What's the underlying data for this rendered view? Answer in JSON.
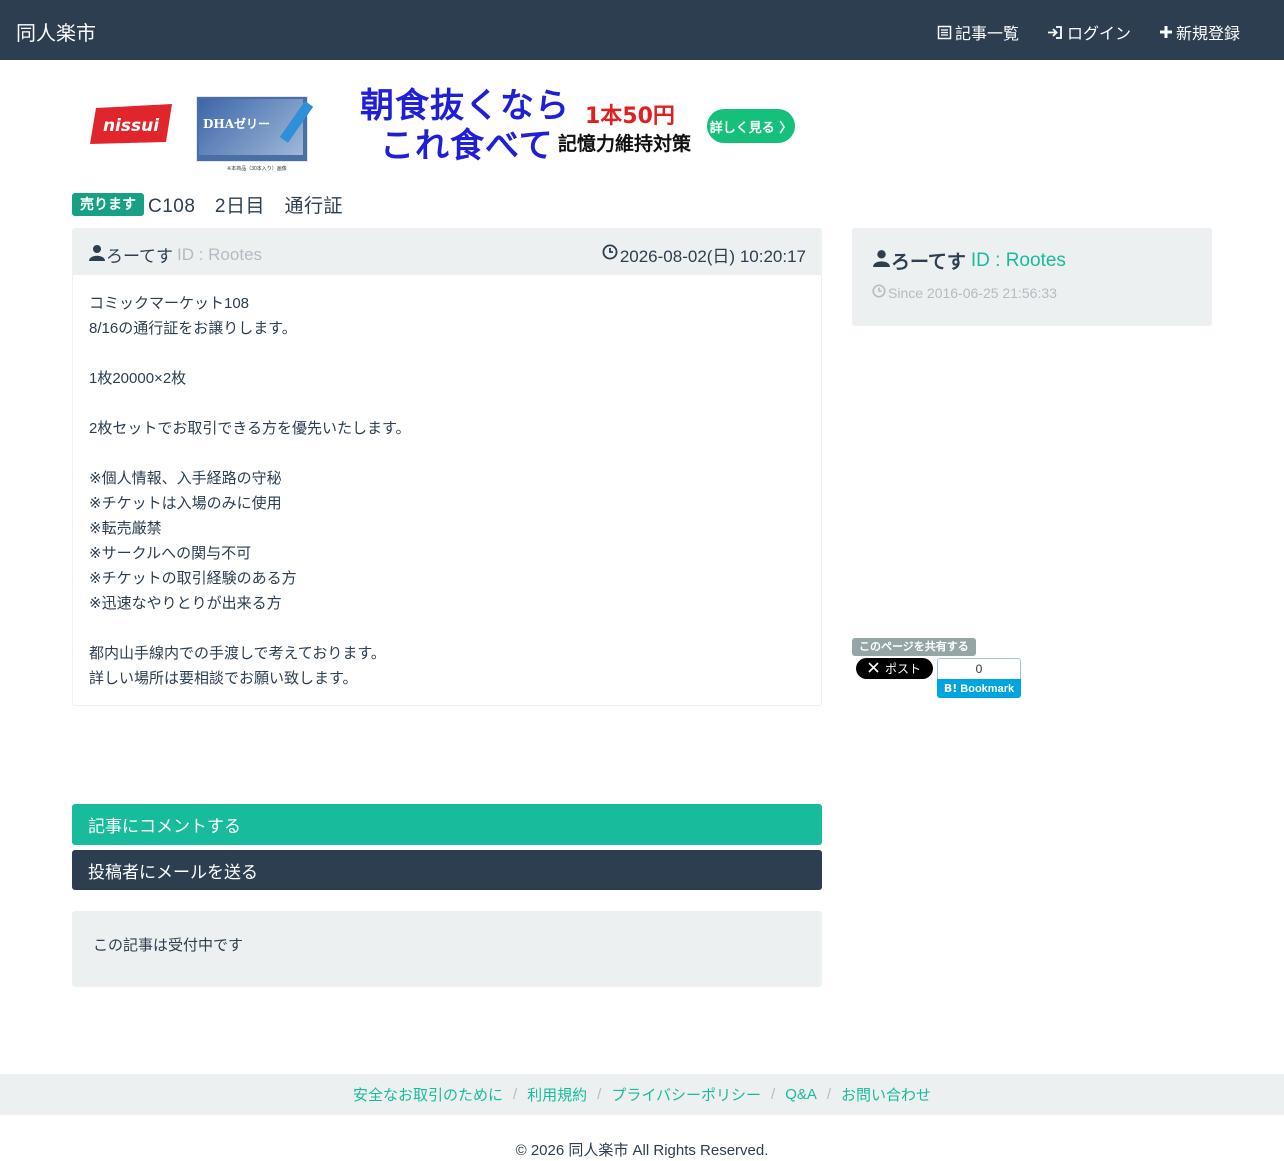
{
  "header": {
    "brand": "同人楽市",
    "nav": {
      "articles": "記事一覧",
      "login": "ログイン",
      "register": "新規登録"
    }
  },
  "ad": {
    "brand_logo": "nissui",
    "product_name": "DHAゼリー",
    "product_caption": "※本商品（30本入り）画像",
    "headline_line1": "朝食抜くなら",
    "headline_line2": "これ食べて",
    "price": "1本50円",
    "subline": "記憶力維持対策",
    "cta": "詳しく見る 〉",
    "colors": {
      "headline": "#1f1fd8",
      "price": "#e02020",
      "cta_bg": "#14c07a",
      "logo": "#e0252c"
    }
  },
  "post": {
    "badge": "売ります",
    "title": "C108　2日目　通行証",
    "author": "ろーてす",
    "author_id": "ID : Rootes",
    "date": "2026-08-02(日) 10:20:17",
    "body": "コミックマーケット108\n8/16の通行証をお譲りします。\n\n1枚20000×2枚\n\n2枚セットでお取引できる方を優先いたします。\n\n※個人情報、入手経路の守秘\n※チケットは入場のみに使用\n※転売厳禁\n※サークルへの関与不可\n※チケットの取引経験のある方\n※迅速なやりとりが出来る方\n\n都内山手線内での手渡しで考えております。\n詳しい場所は要相談でお願い致します。"
  },
  "profile": {
    "name": "ろーてす",
    "id": "ID : Rootes",
    "since": "Since 2016-06-25 21:56:33"
  },
  "share": {
    "label": "このページを共有する",
    "x_label": "ポスト",
    "hatena_count": "0",
    "hatena_label": "Bookmark"
  },
  "actions": {
    "comment": "記事にコメントする",
    "mail": "投稿者にメールを送る",
    "status": "この記事は受付中です"
  },
  "footer": {
    "links": [
      "安全なお取引のために",
      "利用規約",
      "プライバシーポリシー",
      "Q&A",
      "お問い合わせ"
    ],
    "copyright": "© 2026 同人楽市 All Rights Reserved."
  },
  "colors": {
    "navbar": "#2c3e50",
    "accent": "#18bc9c",
    "badge": "#18a085",
    "panel": "#ecf0f1",
    "muted": "#b4bcc2"
  }
}
